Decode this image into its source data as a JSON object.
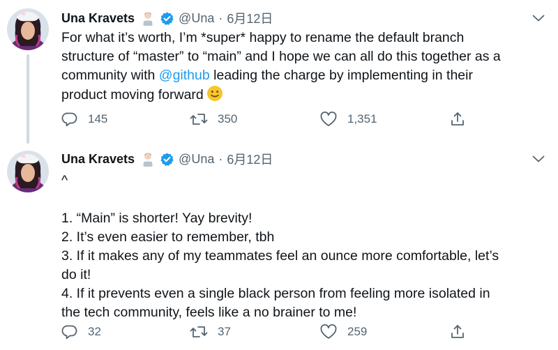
{
  "colors": {
    "text": "#0f1419",
    "secondary": "#536471",
    "link": "#1d9bf0",
    "verified": "#1d9bf0",
    "thread_line": "#cfd9de"
  },
  "tweets": [
    {
      "author_name": "Una Kravets",
      "author_emoji": "woman-technologist-emoji",
      "verified_icon": "verified-badge-icon",
      "handle": "@Una",
      "separator": "·",
      "date": "6月12日",
      "menu_icon": "chevron-down-icon",
      "lines": [
        "For what it’s worth, I’m *super* happy to rename the default branch",
        "structure of “master” to “main” and I hope we can all do this together as a",
        "community with ",
        " leading the charge by implementing in their",
        "product moving forward"
      ],
      "mention": "@github",
      "trailing_emoji": "slightly-smiling-face-emoji",
      "replies": "145",
      "retweets": "350",
      "likes": "1,351",
      "share_icon": "share-icon"
    },
    {
      "author_name": "Una Kravets",
      "author_emoji": "woman-technologist-emoji",
      "verified_icon": "verified-badge-icon",
      "handle": "@Una",
      "separator": "·",
      "date": "6月12日",
      "menu_icon": "chevron-down-icon",
      "lines": [
        "^",
        "",
        "1. “Main” is shorter! Yay brevity!",
        "2. It’s even easier to remember, tbh",
        "3. If it makes any of my teammates feel an ounce more comfortable, let’s",
        "do it!",
        "4. If it prevents even a single black person from feeling more isolated in",
        "the tech community, feels like a no brainer to me!"
      ],
      "replies": "32",
      "retweets": "37",
      "likes": "259",
      "share_icon": "share-icon"
    }
  ]
}
